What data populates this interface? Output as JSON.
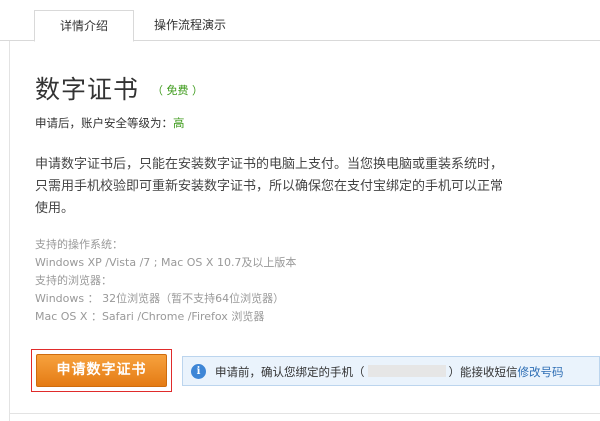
{
  "tabs": [
    {
      "label": "详情介绍",
      "active": true
    },
    {
      "label": "操作流程演示",
      "active": false
    }
  ],
  "product": {
    "title": "数字证书",
    "price_tag": "（ 免费 ）",
    "security_prefix": "申请后，账户安全等级为：",
    "security_level": "高"
  },
  "description": "申请数字证书后，只能在安装数字证书的电脑上支付。当您换电脑或重装系统时，只需用手机校验即可重新安装数字证书，所以确保您在支付宝绑定的手机可以正常使用。",
  "requirements": {
    "os_label": "支持的操作系统：",
    "os_value": "Windows XP /Vista /7 ; Mac OS X 10.7及以上版本",
    "browser_label": "支持的浏览器：",
    "windows_browsers": "Windows ： 32位浏览器（暂不支持64位浏览器）",
    "mac_browsers": "Mac OS X ：Safari /Chrome /Firefox 浏览器"
  },
  "apply_button_label": "申请数字证书",
  "notice": {
    "text_before": "申请前，确认您绑定的手机（",
    "text_after": "）能接收短信",
    "link_label": "修改号码"
  },
  "colors": {
    "accent_orange": "#e47b14",
    "highlight_border": "#e02b2b",
    "green": "#3c9a1a",
    "info_blue": "#3e86d6"
  }
}
